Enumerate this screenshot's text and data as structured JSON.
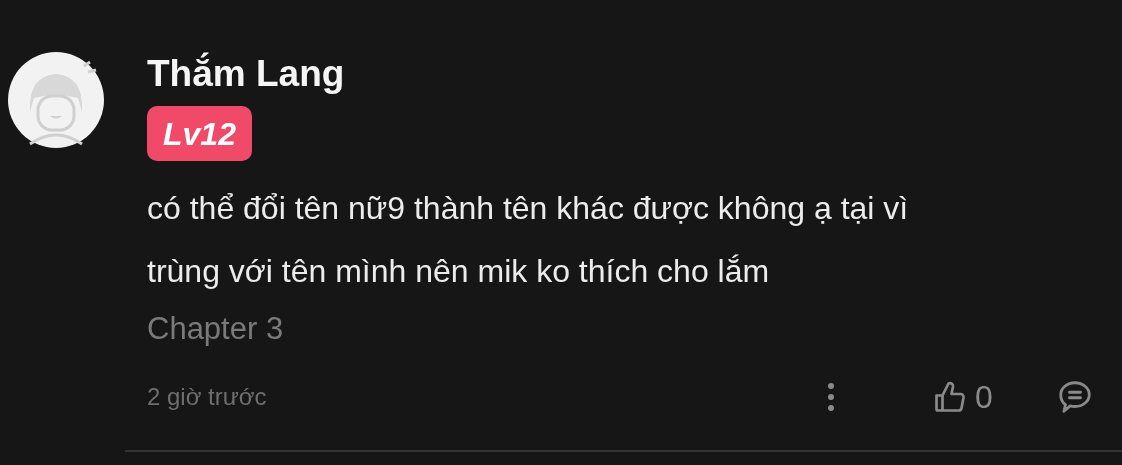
{
  "comment": {
    "author": "Thắm Lang",
    "level_badge": "Lv12",
    "text": "có thể đổi tên nữ9 thành tên khác được không ạ tại vì trùng với tên mình nên mik ko thích cho lắm",
    "chapter": "Chapter 3",
    "time": "2 giờ trước",
    "likes": "0"
  }
}
